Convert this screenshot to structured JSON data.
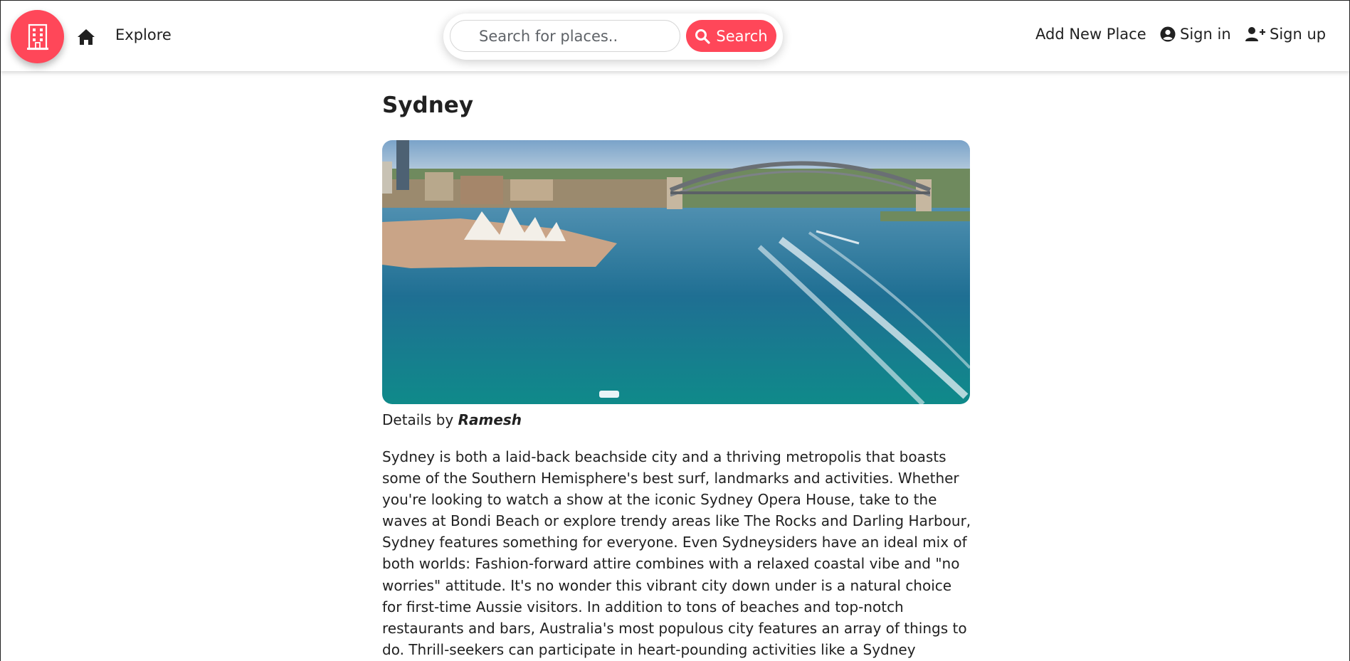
{
  "nav": {
    "explore_label": "Explore",
    "search_placeholder": "Search for places..",
    "search_button_label": "Search",
    "add_place_label": "Add New Place",
    "signin_label": "Sign in",
    "signup_label": "Sign up",
    "brand_color": "#ff4759",
    "icons": [
      "building-logo-icon",
      "home-icon",
      "search-icon",
      "user-circle-icon",
      "user-plus-icon"
    ]
  },
  "place": {
    "title": "Sydney",
    "image_subject": "Sydney Harbour with the Opera House and Harbour Bridge",
    "details_prefix": "Details by",
    "author": "Ramesh",
    "description": "Sydney is both a laid-back beachside city and a thriving metropolis that boasts some of the Southern Hemisphere's best surf, landmarks and activities. Whether you're looking to watch a show at the iconic Sydney Opera House, take to the waves at Bondi Beach or explore trendy areas like The Rocks and Darling Harbour, Sydney features something for everyone. Even Sydneysiders have an ideal mix of both worlds: Fashion-forward attire combines with a relaxed coastal vibe and \"no worries\" attitude. It's no wonder this vibrant city down under is a natural choice for first-time Aussie visitors. In addition to tons of beaches and top-notch restaurants and bars, Australia's most populous city features an array of things to do. Thrill-seekers can participate in heart-pounding activities like a Sydney Harbour Bridge climb, while visitors looking to unwind will"
  }
}
